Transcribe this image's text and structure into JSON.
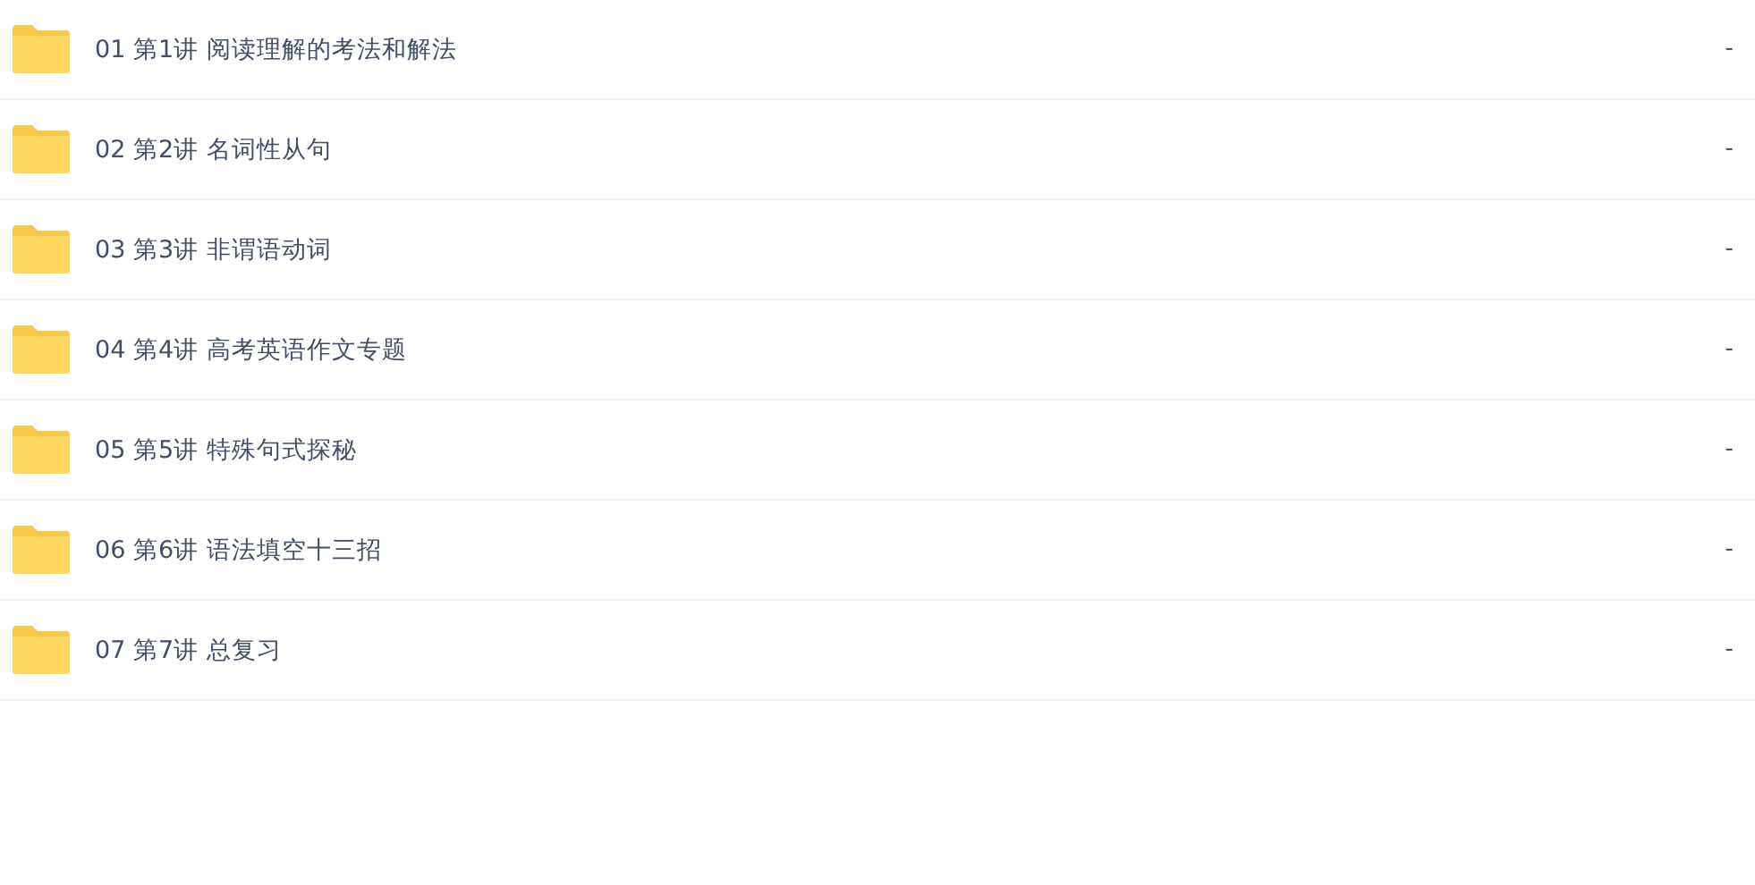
{
  "files": [
    {
      "name": "01 第1讲 阅读理解的考法和解法",
      "size": "-"
    },
    {
      "name": "02 第2讲 名词性从句",
      "size": "-"
    },
    {
      "name": "03 第3讲 非谓语动词",
      "size": "-"
    },
    {
      "name": "04 第4讲 高考英语作文专题",
      "size": "-"
    },
    {
      "name": "05 第5讲 特殊句式探秘",
      "size": "-"
    },
    {
      "name": "06 第6讲 语法填空十三招",
      "size": "-"
    },
    {
      "name": "07 第7讲 总复习",
      "size": "-"
    }
  ]
}
